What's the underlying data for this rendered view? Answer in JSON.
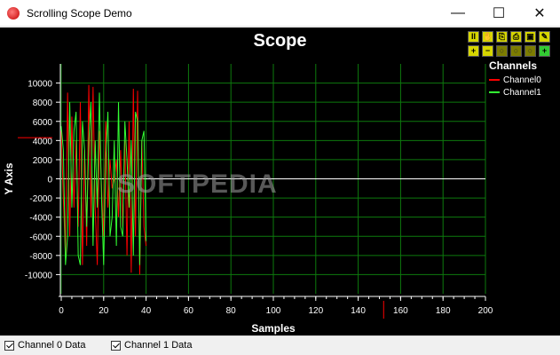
{
  "window": {
    "title": "Scrolling Scope Demo",
    "minimize_glyph": "—",
    "maximize_glyph": "☐",
    "close_glyph": "✕"
  },
  "toolbar": {
    "row1": [
      "pause-icon",
      "hand-pan-icon",
      "copy-icon",
      "print-icon",
      "save-icon",
      "wrench-icon"
    ],
    "row2": [
      "zoom-in-icon",
      "zoom-out-icon",
      "zoom-x-icon",
      "zoom-y-icon",
      "zoom-reset-icon",
      "add-icon"
    ]
  },
  "watermark": "SOFTPEDIA",
  "status": {
    "channel0_label": "Channel 0 Data",
    "channel1_label": "Channel 1 Data",
    "channel0_checked": true,
    "channel1_checked": true
  },
  "chart_data": {
    "type": "line",
    "title": "Scope",
    "xlabel": "Samples",
    "ylabel": "Y Axis",
    "xlim": [
      0,
      200
    ],
    "ylim": [
      -12000,
      12000
    ],
    "x_ticks": [
      0,
      20,
      40,
      60,
      80,
      100,
      120,
      140,
      160,
      180,
      200
    ],
    "y_ticks": [
      -10000,
      -8000,
      -6000,
      -4000,
      -2000,
      0,
      2000,
      4000,
      6000,
      8000,
      10000
    ],
    "grid": true,
    "legend_title": "Channels",
    "legend_position": "right",
    "series": [
      {
        "name": "Channel0",
        "color": "#ff0000",
        "x": [
          0,
          1,
          2,
          3,
          4,
          5,
          6,
          7,
          8,
          9,
          10,
          11,
          12,
          13,
          14,
          15,
          16,
          17,
          18,
          19,
          20,
          21,
          22,
          23,
          24,
          25,
          26,
          27,
          28,
          29,
          30,
          31,
          32,
          33,
          34,
          35,
          36,
          37,
          38,
          39,
          40
        ],
        "values": [
          5000,
          -2000,
          -8000,
          9000,
          -6000,
          6500,
          -3000,
          4000,
          -5000,
          8000,
          -9000,
          3000,
          -7000,
          9800,
          -4000,
          9600,
          -3000,
          -9000,
          5000,
          -1000,
          -6000,
          6000,
          -3000,
          2000,
          -1000,
          0,
          2000,
          -4000,
          3000,
          -5000,
          4000,
          -8000,
          6000,
          -9800,
          9400,
          -6000,
          9200,
          -10000,
          4000,
          -5000,
          -7000
        ]
      },
      {
        "name": "Channel1",
        "color": "#33ff33",
        "x": [
          0,
          1,
          2,
          3,
          4,
          5,
          6,
          7,
          8,
          9,
          10,
          11,
          12,
          13,
          14,
          15,
          16,
          17,
          18,
          19,
          20,
          21,
          22,
          23,
          24,
          25,
          26,
          27,
          28,
          29,
          30,
          31,
          32,
          33,
          34,
          35,
          36,
          37,
          38,
          39,
          40
        ],
        "values": [
          5500,
          3000,
          -9000,
          -6000,
          8000,
          -3000,
          5000,
          7000,
          -8000,
          -9000,
          6000,
          3000,
          -5000,
          4000,
          8000,
          -7000,
          4000,
          -3000,
          9000,
          -2000,
          -9000,
          2000,
          7000,
          -6000,
          -4000,
          4000,
          -7000,
          8000,
          -5000,
          -6000,
          6000,
          2000,
          -3000,
          4000,
          -8000,
          7000,
          6000,
          -9000,
          4000,
          5000,
          -6500
        ]
      }
    ],
    "cursor_markers": [
      {
        "axis": "x",
        "value": 152,
        "color": "#ff0000"
      },
      {
        "axis": "y",
        "value": 4300,
        "color": "#ff0000"
      }
    ]
  }
}
